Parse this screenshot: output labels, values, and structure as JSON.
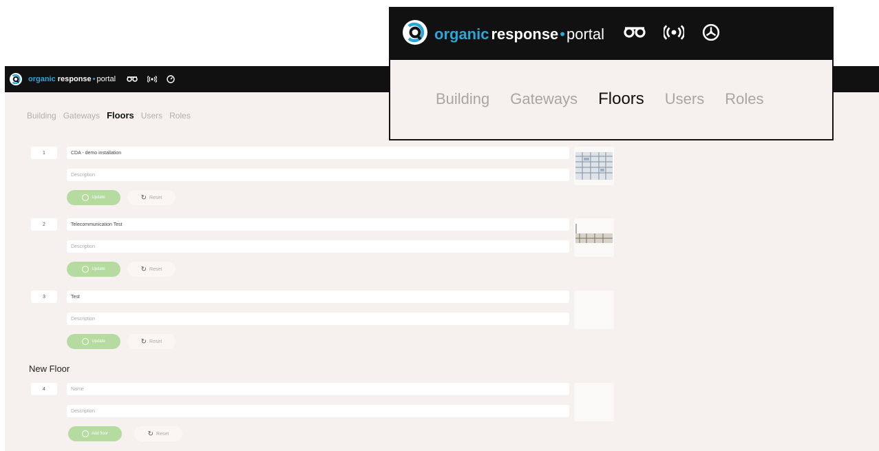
{
  "brand": {
    "organic": "organic",
    "response": "response",
    "dot": "•",
    "portal": "portal",
    "accent_color": "#2aa6d9"
  },
  "topbar_icons": [
    "sensors-icon",
    "wireless-icon",
    "dashboard-icon"
  ],
  "nav": {
    "items": [
      {
        "label": "Building",
        "active": false
      },
      {
        "label": "Gateways",
        "active": false
      },
      {
        "label": "Floors",
        "active": true
      },
      {
        "label": "Users",
        "active": false
      },
      {
        "label": "Roles",
        "active": false
      }
    ]
  },
  "floors": [
    {
      "number": "1",
      "name": "CDA - demo installation",
      "description_placeholder": "Description",
      "save_label": "Update",
      "reset_label": "Reset",
      "has_plan": true
    },
    {
      "number": "2",
      "name": "Telecommunication Test",
      "description_placeholder": "Description",
      "save_label": "Update",
      "reset_label": "Reset",
      "has_plan": true
    },
    {
      "number": "3",
      "name": "Test",
      "description_placeholder": "Description",
      "save_label": "Update",
      "reset_label": "Reset",
      "has_plan": false
    }
  ],
  "new_floor": {
    "heading": "New Floor",
    "number": "4",
    "name_placeholder": "Name",
    "description_placeholder": "Description",
    "add_label": "Add floor",
    "reset_label": "Reset"
  }
}
